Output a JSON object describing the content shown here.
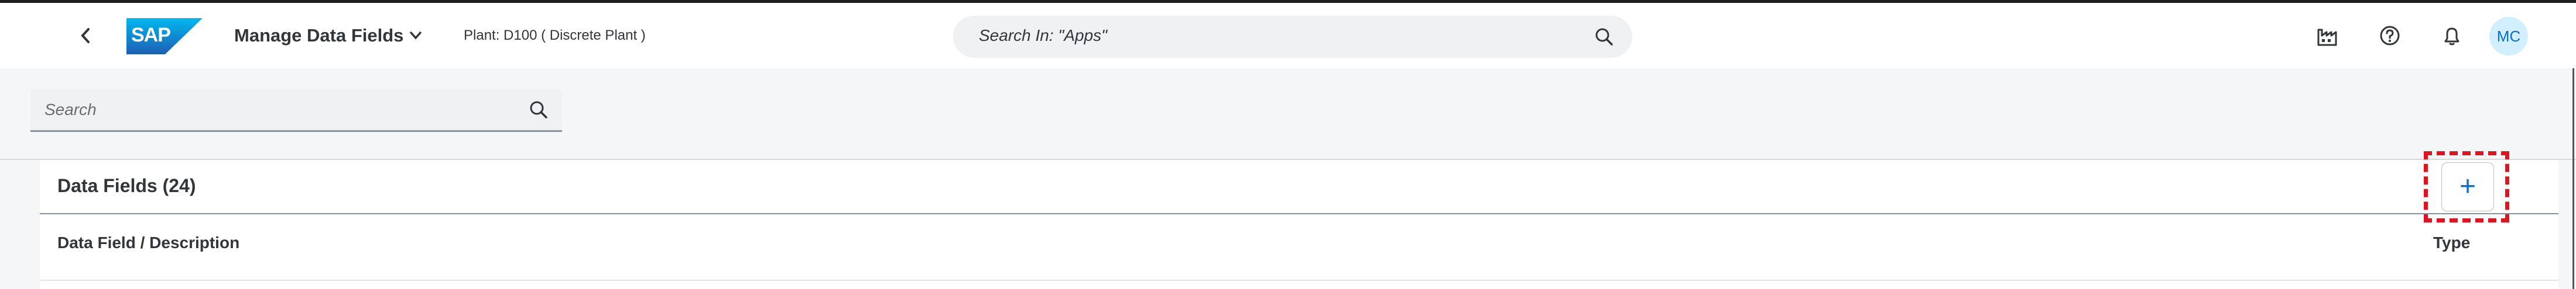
{
  "shell": {
    "app_title": "Manage Data Fields",
    "plant": "Plant: D100 ( Discrete Plant )",
    "search_placeholder": "Search In: \"Apps\"",
    "avatar_initials": "MC",
    "logo_text": "SAP"
  },
  "page": {
    "search_placeholder": "Search"
  },
  "table": {
    "title": "Data Fields (24)",
    "columns": [
      "Data Field / Description",
      "Type"
    ],
    "add_label": "+"
  },
  "colors": {
    "accent": "#0a6ed1",
    "highlight": "#e0141e",
    "sap_blue": "#0070f2"
  }
}
